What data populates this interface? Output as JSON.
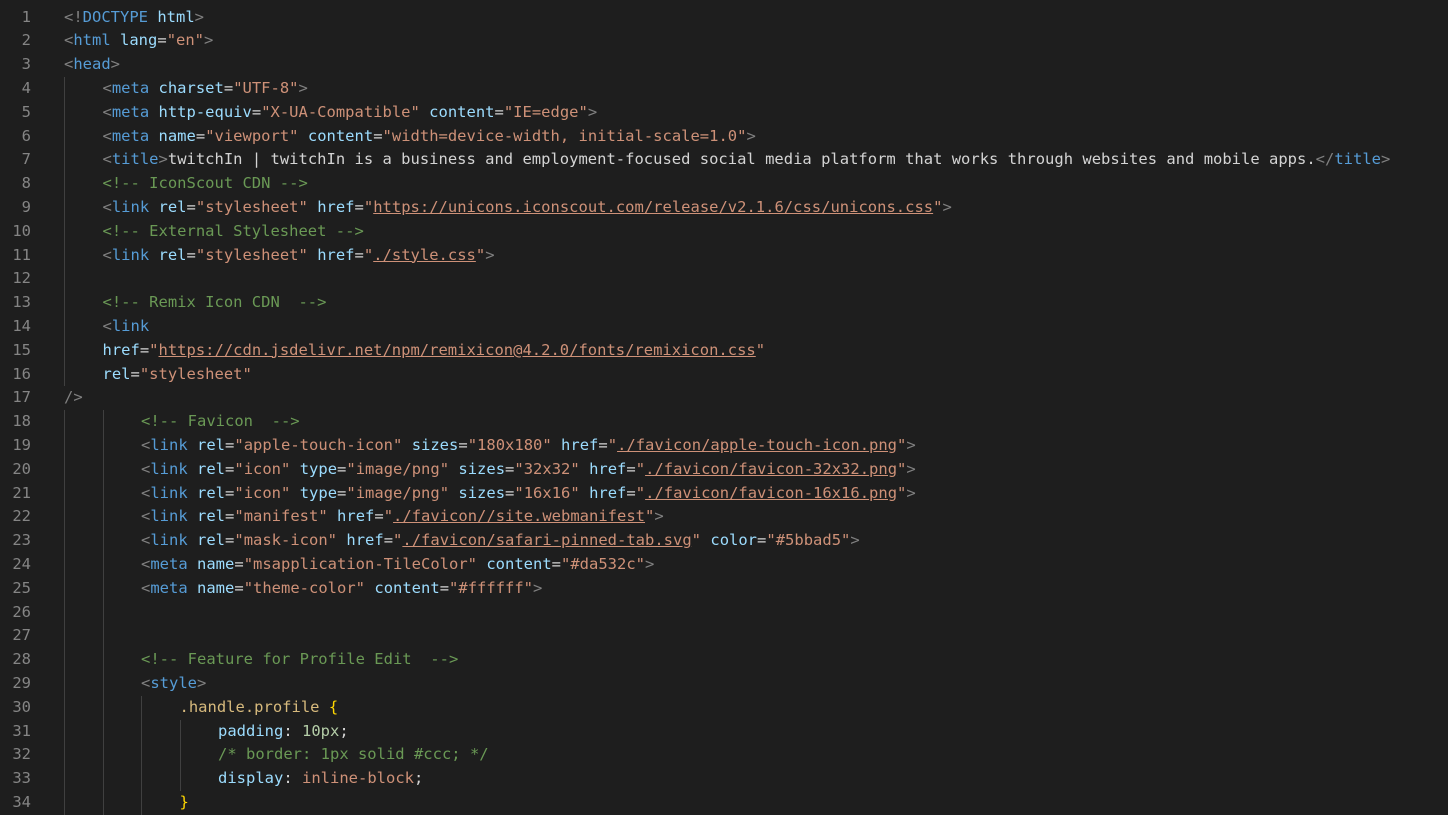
{
  "editor": {
    "lines": [
      {
        "n": "1",
        "indent": 0,
        "tokens": [
          [
            "punc",
            "<!"
          ],
          [
            "tag",
            "DOCTYPE"
          ],
          [
            "text",
            " "
          ],
          [
            "attr",
            "html"
          ],
          [
            "punc",
            ">"
          ]
        ]
      },
      {
        "n": "2",
        "indent": 0,
        "tokens": [
          [
            "punc",
            "<"
          ],
          [
            "tag",
            "html"
          ],
          [
            "text",
            " "
          ],
          [
            "attr",
            "lang"
          ],
          [
            "text",
            "="
          ],
          [
            "str",
            "\"en\""
          ],
          [
            "punc",
            ">"
          ]
        ]
      },
      {
        "n": "3",
        "indent": 0,
        "tokens": [
          [
            "punc",
            "<"
          ],
          [
            "tag",
            "head"
          ],
          [
            "punc",
            ">"
          ]
        ]
      },
      {
        "n": "4",
        "indent": 1,
        "tokens": [
          [
            "punc",
            "<"
          ],
          [
            "tag",
            "meta"
          ],
          [
            "text",
            " "
          ],
          [
            "attr",
            "charset"
          ],
          [
            "text",
            "="
          ],
          [
            "str",
            "\"UTF-8\""
          ],
          [
            "punc",
            ">"
          ]
        ]
      },
      {
        "n": "5",
        "indent": 1,
        "tokens": [
          [
            "punc",
            "<"
          ],
          [
            "tag",
            "meta"
          ],
          [
            "text",
            " "
          ],
          [
            "attr",
            "http-equiv"
          ],
          [
            "text",
            "="
          ],
          [
            "str",
            "\"X-UA-Compatible\""
          ],
          [
            "text",
            " "
          ],
          [
            "attr",
            "content"
          ],
          [
            "text",
            "="
          ],
          [
            "str",
            "\"IE=edge\""
          ],
          [
            "punc",
            ">"
          ]
        ]
      },
      {
        "n": "6",
        "indent": 1,
        "tokens": [
          [
            "punc",
            "<"
          ],
          [
            "tag",
            "meta"
          ],
          [
            "text",
            " "
          ],
          [
            "attr",
            "name"
          ],
          [
            "text",
            "="
          ],
          [
            "str",
            "\"viewport\""
          ],
          [
            "text",
            " "
          ],
          [
            "attr",
            "content"
          ],
          [
            "text",
            "="
          ],
          [
            "str",
            "\"width=device-width, initial-scale=1.0\""
          ],
          [
            "punc",
            ">"
          ]
        ]
      },
      {
        "n": "7",
        "indent": 1,
        "tokens": [
          [
            "punc",
            "<"
          ],
          [
            "tag",
            "title"
          ],
          [
            "punc",
            ">"
          ],
          [
            "text",
            "twitchIn | twitchIn is a business and employment-focused social media platform that works through websites and mobile apps."
          ],
          [
            "punc",
            "</"
          ],
          [
            "tag",
            "title"
          ],
          [
            "punc",
            ">"
          ]
        ]
      },
      {
        "n": "8",
        "indent": 1,
        "tokens": [
          [
            "com",
            "<!-- IconScout CDN -->"
          ]
        ]
      },
      {
        "n": "9",
        "indent": 1,
        "tokens": [
          [
            "punc",
            "<"
          ],
          [
            "tag",
            "link"
          ],
          [
            "text",
            " "
          ],
          [
            "attr",
            "rel"
          ],
          [
            "text",
            "="
          ],
          [
            "str",
            "\"stylesheet\""
          ],
          [
            "text",
            " "
          ],
          [
            "attr",
            "href"
          ],
          [
            "text",
            "="
          ],
          [
            "str",
            "\""
          ],
          [
            "link",
            "https://unicons.iconscout.com/release/v2.1.6/css/unicons.css"
          ],
          [
            "str",
            "\""
          ],
          [
            "punc",
            ">"
          ]
        ]
      },
      {
        "n": "10",
        "indent": 1,
        "tokens": [
          [
            "com",
            "<!-- External Stylesheet -->"
          ]
        ]
      },
      {
        "n": "11",
        "indent": 1,
        "tokens": [
          [
            "punc",
            "<"
          ],
          [
            "tag",
            "link"
          ],
          [
            "text",
            " "
          ],
          [
            "attr",
            "rel"
          ],
          [
            "text",
            "="
          ],
          [
            "str",
            "\"stylesheet\""
          ],
          [
            "text",
            " "
          ],
          [
            "attr",
            "href"
          ],
          [
            "text",
            "="
          ],
          [
            "str",
            "\""
          ],
          [
            "link",
            "./style.css"
          ],
          [
            "str",
            "\""
          ],
          [
            "punc",
            ">"
          ]
        ]
      },
      {
        "n": "12",
        "indent": 1,
        "tokens": []
      },
      {
        "n": "13",
        "indent": 1,
        "tokens": [
          [
            "com",
            "<!-- Remix Icon CDN  -->"
          ]
        ]
      },
      {
        "n": "14",
        "indent": 1,
        "tokens": [
          [
            "punc",
            "<"
          ],
          [
            "tag",
            "link"
          ]
        ]
      },
      {
        "n": "15",
        "indent": 1,
        "tokens": [
          [
            "attr",
            "href"
          ],
          [
            "text",
            "="
          ],
          [
            "str",
            "\""
          ],
          [
            "link",
            "https://cdn.jsdelivr.net/npm/remixicon@4.2.0/fonts/remixicon.css"
          ],
          [
            "str",
            "\""
          ]
        ]
      },
      {
        "n": "16",
        "indent": 1,
        "tokens": [
          [
            "attr",
            "rel"
          ],
          [
            "text",
            "="
          ],
          [
            "str",
            "\"stylesheet\""
          ]
        ]
      },
      {
        "n": "17",
        "indent": 0,
        "tokens": [
          [
            "punc",
            "/>"
          ]
        ]
      },
      {
        "n": "18",
        "indent": 2,
        "tokens": [
          [
            "com",
            "<!-- Favicon  -->"
          ]
        ]
      },
      {
        "n": "19",
        "indent": 2,
        "tokens": [
          [
            "punc",
            "<"
          ],
          [
            "tag",
            "link"
          ],
          [
            "text",
            " "
          ],
          [
            "attr",
            "rel"
          ],
          [
            "text",
            "="
          ],
          [
            "str",
            "\"apple-touch-icon\""
          ],
          [
            "text",
            " "
          ],
          [
            "attr",
            "sizes"
          ],
          [
            "text",
            "="
          ],
          [
            "str",
            "\"180x180\""
          ],
          [
            "text",
            " "
          ],
          [
            "attr",
            "href"
          ],
          [
            "text",
            "="
          ],
          [
            "str",
            "\""
          ],
          [
            "link",
            "./favicon/apple-touch-icon.png"
          ],
          [
            "str",
            "\""
          ],
          [
            "punc",
            ">"
          ]
        ]
      },
      {
        "n": "20",
        "indent": 2,
        "tokens": [
          [
            "punc",
            "<"
          ],
          [
            "tag",
            "link"
          ],
          [
            "text",
            " "
          ],
          [
            "attr",
            "rel"
          ],
          [
            "text",
            "="
          ],
          [
            "str",
            "\"icon\""
          ],
          [
            "text",
            " "
          ],
          [
            "attr",
            "type"
          ],
          [
            "text",
            "="
          ],
          [
            "str",
            "\"image/png\""
          ],
          [
            "text",
            " "
          ],
          [
            "attr",
            "sizes"
          ],
          [
            "text",
            "="
          ],
          [
            "str",
            "\"32x32\""
          ],
          [
            "text",
            " "
          ],
          [
            "attr",
            "href"
          ],
          [
            "text",
            "="
          ],
          [
            "str",
            "\""
          ],
          [
            "link",
            "./favicon/favicon-32x32.png"
          ],
          [
            "str",
            "\""
          ],
          [
            "punc",
            ">"
          ]
        ]
      },
      {
        "n": "21",
        "indent": 2,
        "tokens": [
          [
            "punc",
            "<"
          ],
          [
            "tag",
            "link"
          ],
          [
            "text",
            " "
          ],
          [
            "attr",
            "rel"
          ],
          [
            "text",
            "="
          ],
          [
            "str",
            "\"icon\""
          ],
          [
            "text",
            " "
          ],
          [
            "attr",
            "type"
          ],
          [
            "text",
            "="
          ],
          [
            "str",
            "\"image/png\""
          ],
          [
            "text",
            " "
          ],
          [
            "attr",
            "sizes"
          ],
          [
            "text",
            "="
          ],
          [
            "str",
            "\"16x16\""
          ],
          [
            "text",
            " "
          ],
          [
            "attr",
            "href"
          ],
          [
            "text",
            "="
          ],
          [
            "str",
            "\""
          ],
          [
            "link",
            "./favicon/favicon-16x16.png"
          ],
          [
            "str",
            "\""
          ],
          [
            "punc",
            ">"
          ]
        ]
      },
      {
        "n": "22",
        "indent": 2,
        "tokens": [
          [
            "punc",
            "<"
          ],
          [
            "tag",
            "link"
          ],
          [
            "text",
            " "
          ],
          [
            "attr",
            "rel"
          ],
          [
            "text",
            "="
          ],
          [
            "str",
            "\"manifest\""
          ],
          [
            "text",
            " "
          ],
          [
            "attr",
            "href"
          ],
          [
            "text",
            "="
          ],
          [
            "str",
            "\""
          ],
          [
            "link",
            "./favicon//site.webmanifest"
          ],
          [
            "str",
            "\""
          ],
          [
            "punc",
            ">"
          ]
        ]
      },
      {
        "n": "23",
        "indent": 2,
        "tokens": [
          [
            "punc",
            "<"
          ],
          [
            "tag",
            "link"
          ],
          [
            "text",
            " "
          ],
          [
            "attr",
            "rel"
          ],
          [
            "text",
            "="
          ],
          [
            "str",
            "\"mask-icon\""
          ],
          [
            "text",
            " "
          ],
          [
            "attr",
            "href"
          ],
          [
            "text",
            "="
          ],
          [
            "str",
            "\""
          ],
          [
            "link",
            "./favicon/safari-pinned-tab.svg"
          ],
          [
            "str",
            "\""
          ],
          [
            "text",
            " "
          ],
          [
            "attr",
            "color"
          ],
          [
            "text",
            "="
          ],
          [
            "str",
            "\"#5bbad5\""
          ],
          [
            "punc",
            ">"
          ]
        ]
      },
      {
        "n": "24",
        "indent": 2,
        "tokens": [
          [
            "punc",
            "<"
          ],
          [
            "tag",
            "meta"
          ],
          [
            "text",
            " "
          ],
          [
            "attr",
            "name"
          ],
          [
            "text",
            "="
          ],
          [
            "str",
            "\"msapplication-TileColor\""
          ],
          [
            "text",
            " "
          ],
          [
            "attr",
            "content"
          ],
          [
            "text",
            "="
          ],
          [
            "str",
            "\"#da532c\""
          ],
          [
            "punc",
            ">"
          ]
        ]
      },
      {
        "n": "25",
        "indent": 2,
        "tokens": [
          [
            "punc",
            "<"
          ],
          [
            "tag",
            "meta"
          ],
          [
            "text",
            " "
          ],
          [
            "attr",
            "name"
          ],
          [
            "text",
            "="
          ],
          [
            "str",
            "\"theme-color\""
          ],
          [
            "text",
            " "
          ],
          [
            "attr",
            "content"
          ],
          [
            "text",
            "="
          ],
          [
            "str",
            "\"#ffffff\""
          ],
          [
            "punc",
            ">"
          ]
        ]
      },
      {
        "n": "26",
        "indent": 2,
        "tokens": []
      },
      {
        "n": "27",
        "indent": 2,
        "tokens": []
      },
      {
        "n": "28",
        "indent": 2,
        "tokens": [
          [
            "com",
            "<!-- Feature for Profile Edit  -->"
          ]
        ]
      },
      {
        "n": "29",
        "indent": 2,
        "tokens": [
          [
            "punc",
            "<"
          ],
          [
            "tag",
            "style"
          ],
          [
            "punc",
            ">"
          ]
        ]
      },
      {
        "n": "30",
        "indent": 3,
        "tokens": [
          [
            "sel",
            ".handle.profile"
          ],
          [
            "text",
            " "
          ],
          [
            "brace",
            "{"
          ]
        ]
      },
      {
        "n": "31",
        "indent": 4,
        "tokens": [
          [
            "prop",
            "padding"
          ],
          [
            "text",
            ": "
          ],
          [
            "num",
            "10px"
          ],
          [
            "text",
            ";"
          ]
        ]
      },
      {
        "n": "32",
        "indent": 4,
        "tokens": [
          [
            "com",
            "/* border: 1px solid #ccc; */"
          ]
        ]
      },
      {
        "n": "33",
        "indent": 4,
        "tokens": [
          [
            "prop",
            "display"
          ],
          [
            "text",
            ": "
          ],
          [
            "val",
            "inline-block"
          ],
          [
            "text",
            ";"
          ]
        ]
      },
      {
        "n": "34",
        "indent": 3,
        "tokens": [
          [
            "brace",
            "}"
          ]
        ]
      }
    ]
  }
}
